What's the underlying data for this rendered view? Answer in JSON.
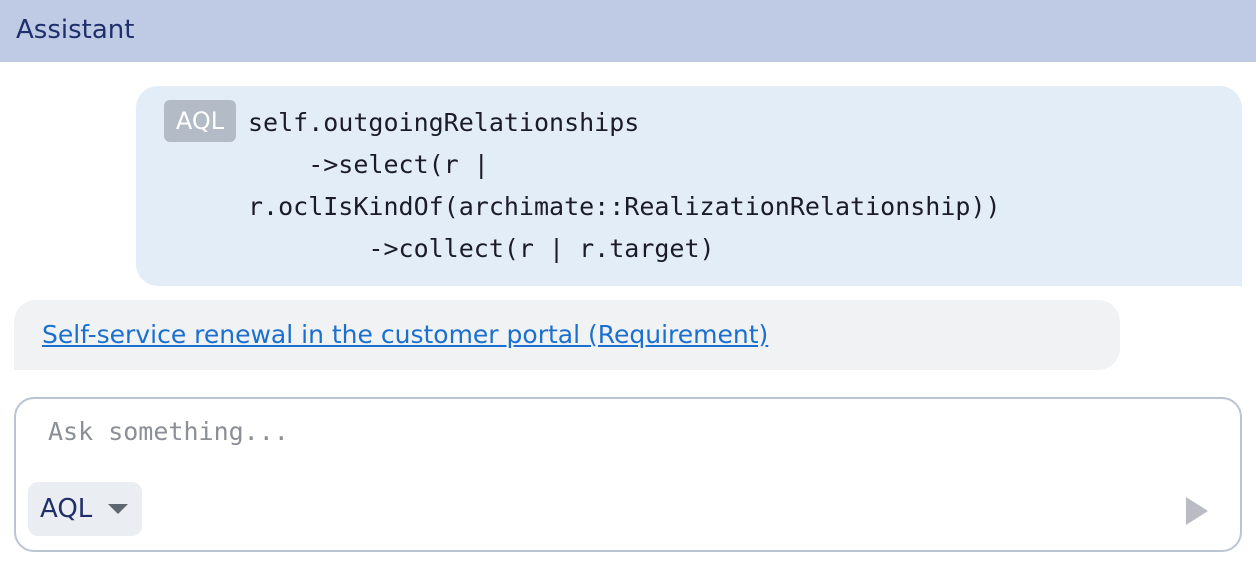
{
  "header": {
    "title": "Assistant"
  },
  "user_message": {
    "badge": "AQL",
    "code": "self.outgoingRelationships\n    ->select(r |\nr.oclIsKindOf(archimate::RealizationRelationship))\n        ->collect(r | r.target)"
  },
  "result_message": {
    "link_text": "Self-service renewal in the customer portal (Requirement)"
  },
  "composer": {
    "placeholder": "Ask something...",
    "language": "AQL",
    "send_icon": "send-icon"
  },
  "colors": {
    "header_bg": "#bfcae5",
    "user_bubble_bg": "#e3edf7",
    "result_bubble_bg": "#f0f2f4",
    "link": "#1a6fcf"
  }
}
